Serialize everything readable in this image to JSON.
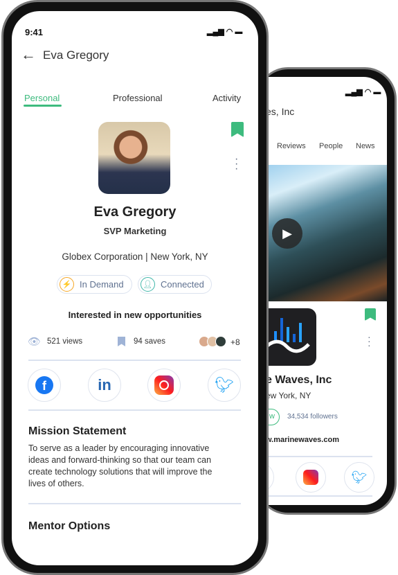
{
  "company_phone": {
    "title_partial": "es, Inc",
    "tabs": [
      "Reviews",
      "People",
      "News"
    ],
    "name_partial": "e Waves, Inc",
    "location_partial": "ew York, NY",
    "follow_partial": "w",
    "followers": "34,534 followers",
    "website_partial": "w.marinewaves.com",
    "social": [
      "linkedin",
      "instagram",
      "twitter"
    ]
  },
  "profile_phone": {
    "status_time": "9:41",
    "header_title": "Eva Gregory",
    "tabs": [
      {
        "label": "Personal",
        "active": true
      },
      {
        "label": "Professional",
        "active": false
      },
      {
        "label": "Activity",
        "active": false
      }
    ],
    "name": "Eva Gregory",
    "role": "SVP Marketing",
    "company_location": "Globex Corporation | New York, NY",
    "badges": [
      {
        "label": "In Demand",
        "icon": "lightning-icon",
        "color": "#f5a623"
      },
      {
        "label": "Connected",
        "icon": "user-check-icon",
        "color": "#3fb6a8"
      }
    ],
    "opportunity": "Interested in new opportunities",
    "views": "521 views",
    "saves": "94 saves",
    "more_people": "+8",
    "social": [
      "facebook",
      "linkedin",
      "instagram",
      "twitter"
    ],
    "mission_title": "Mission Statement",
    "mission_text": "To serve as a leader by encouraging innovative ideas and forward-thinking so that our team can create technology solutions that will improve the lives of others.",
    "mentor_title": "Mentor Options"
  },
  "colors": {
    "accent": "#3dbb7e",
    "text": "#2b2b2b",
    "muted": "#5f7190",
    "divider": "#dbe2ef"
  }
}
